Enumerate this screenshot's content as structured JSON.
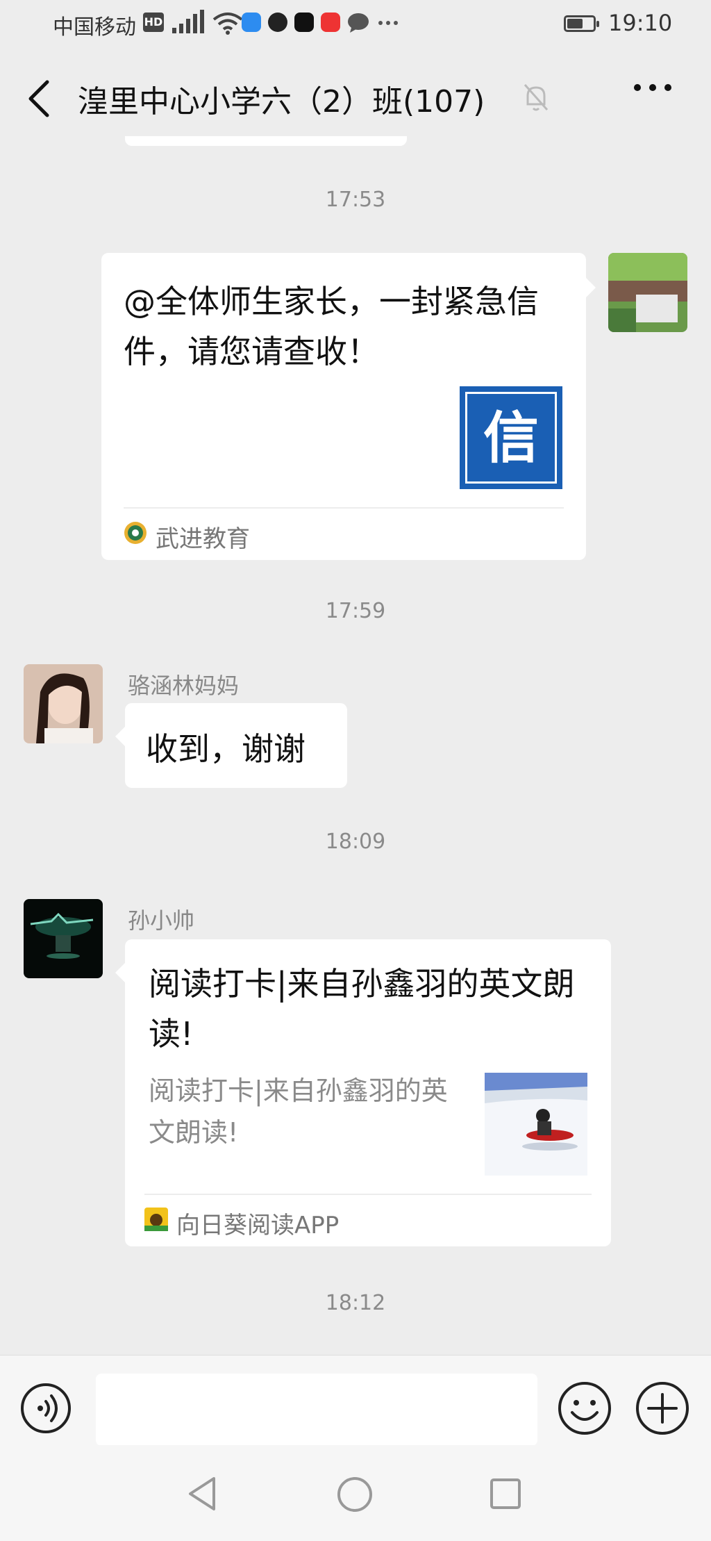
{
  "status_bar": {
    "carrier": "中国移动",
    "hd": "HD",
    "time": "19:10",
    "battery_level": 0.6
  },
  "header": {
    "title": "湟里中心小学六（2）班(107)"
  },
  "messages": [
    {
      "time": "17:53",
      "card_title": "@全体师生家长，一封紧急信件，请您请查收！",
      "thumb_char": "信",
      "source": "武进教育"
    },
    {
      "time": "17:59",
      "sender": "骆涵林妈妈",
      "text": "收到，谢谢"
    },
    {
      "time": "18:09",
      "sender": "孙小帅",
      "card_title": "阅读打卡|来自孙鑫羽的英文朗读!",
      "card_desc": "阅读打卡|来自孙鑫羽的英文朗读!",
      "source": "向日葵阅读APP"
    },
    {
      "time": "18:12"
    }
  ],
  "input": {
    "placeholder": ""
  },
  "colors": {
    "background": "#ededed",
    "bubble": "#ffffff",
    "brand_blue": "#1a5fb4"
  }
}
